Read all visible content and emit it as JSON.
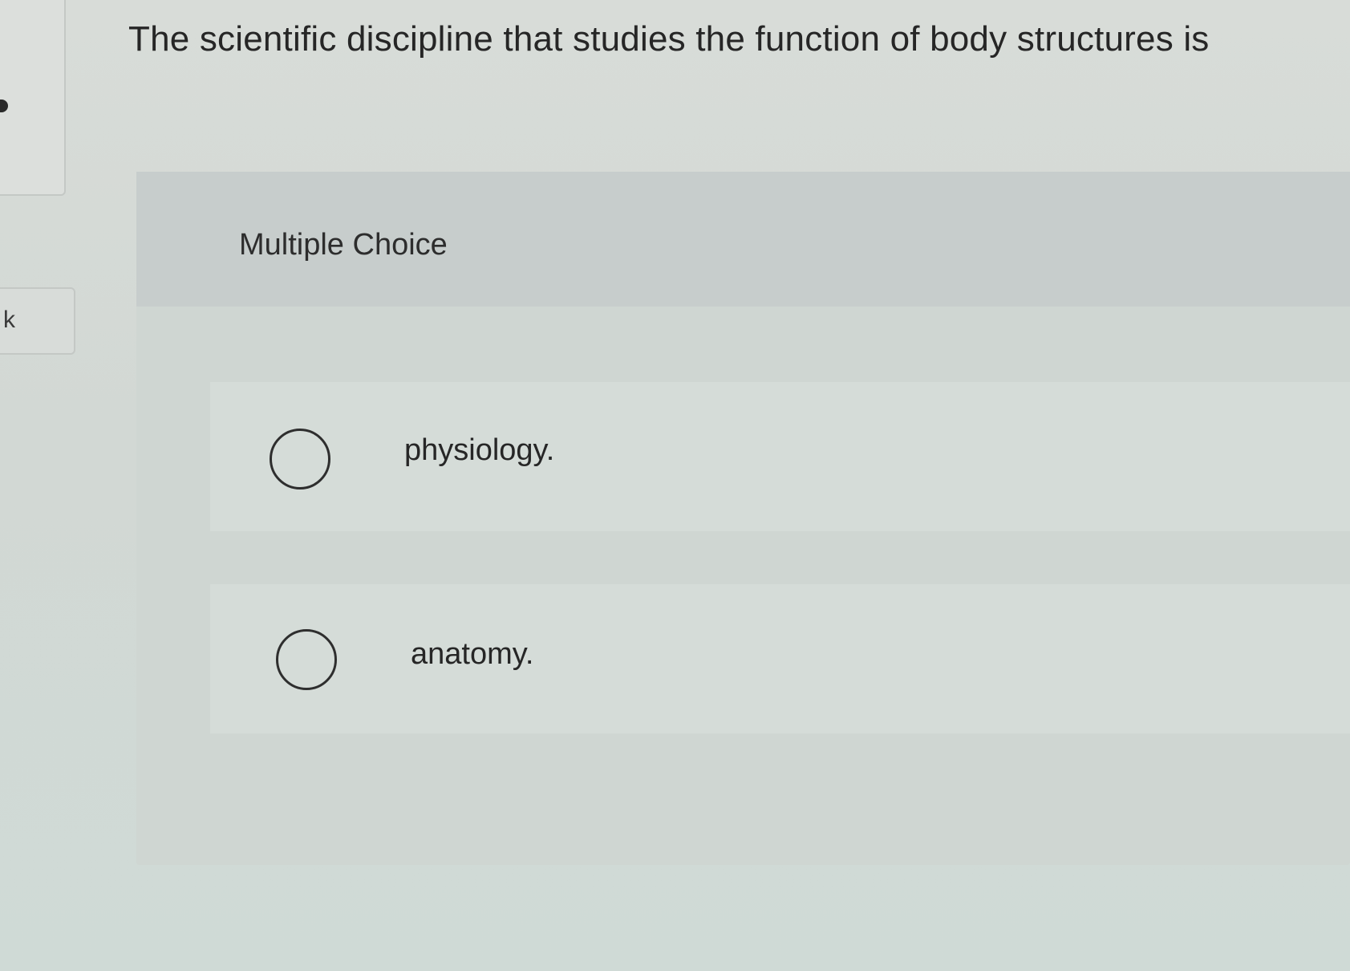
{
  "sidebar": {
    "tab_label": "k"
  },
  "question": {
    "text": "The scientific discipline that studies the function of body structures is",
    "type_label": "Multiple Choice",
    "options": [
      {
        "label": "physiology.",
        "selected": false
      },
      {
        "label": "anatomy.",
        "selected": false
      }
    ]
  }
}
